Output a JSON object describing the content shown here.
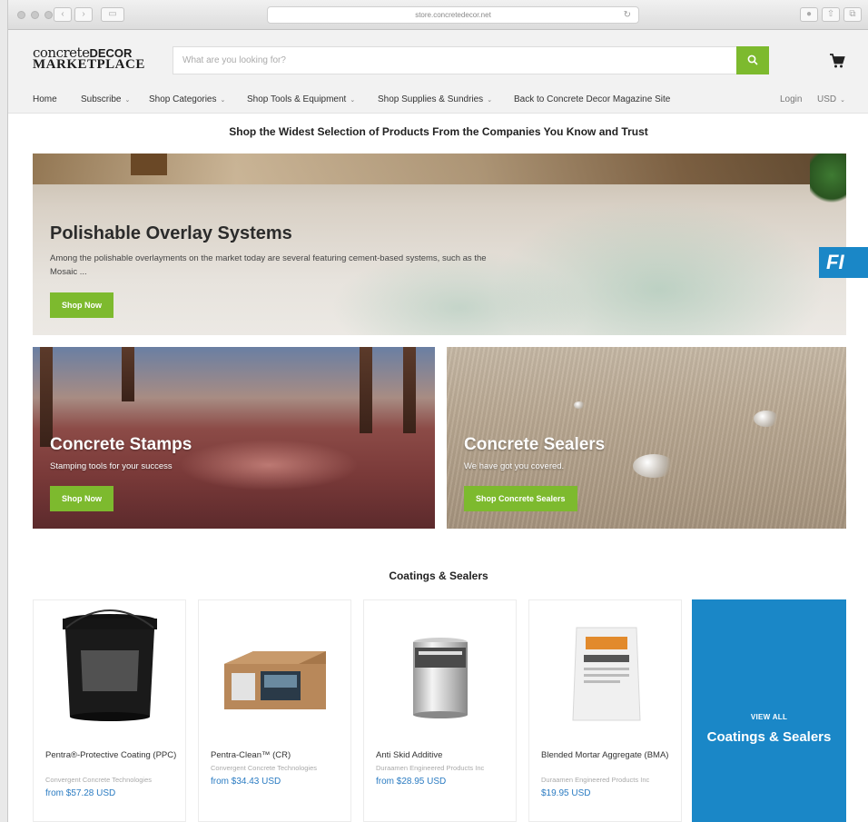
{
  "browser": {
    "url": "store.concretedecor.net"
  },
  "header": {
    "logo_line1_prefix": "concrete",
    "logo_line1_bold": "DECOR",
    "logo_line2": "MARKETPLACE",
    "search_placeholder": "What are you looking for?"
  },
  "nav": {
    "items": [
      {
        "label": "Home"
      },
      {
        "label": "Subscribe"
      },
      {
        "label": "Shop Categories"
      },
      {
        "label": "Shop Tools & Equipment"
      },
      {
        "label": "Shop Supplies & Sundries"
      },
      {
        "label": "Back to Concrete Decor Magazine Site"
      }
    ],
    "login": "Login",
    "currency": "USD"
  },
  "tagline": "Shop the Widest Selection of Products From the Companies You Know and Trust",
  "banners": {
    "overlay": {
      "title": "Polishable Overlay Systems",
      "desc": "Among the polishable overlayments on the market today are several featuring cement-based systems, such as the Mosaic ...",
      "button": "Shop Now"
    },
    "stamps": {
      "title": "Concrete Stamps",
      "desc": "Stamping tools for your success",
      "button": "Shop Now"
    },
    "sealers": {
      "title": "Concrete Sealers",
      "desc": "We have got you covered.",
      "button": "Shop Concrete Sealers"
    }
  },
  "side_badge": "FI",
  "section": {
    "title": "Coatings & Sealers",
    "products": [
      {
        "name": "Pentra®-Protective Coating (PPC)",
        "vendor": "Convergent Concrete Technologies",
        "price": "from $57.28 USD"
      },
      {
        "name": "Pentra-Clean™ (CR)",
        "vendor": "Convergent Concrete Technologies",
        "price": "from $34.43 USD"
      },
      {
        "name": "Anti Skid Additive",
        "vendor": "Duraamen Engineered Products Inc",
        "price": "from $28.95 USD"
      },
      {
        "name": "Blended Mortar Aggregate (BMA)",
        "vendor": "Duraamen Engineered Products Inc",
        "price": "$19.95 USD"
      }
    ],
    "view_all_top": "VIEW ALL",
    "view_all_main": "Coatings & Sealers"
  },
  "colors": {
    "accent_green": "#7dba2e",
    "accent_blue": "#1a87c7",
    "price_blue": "#2a7bc2"
  }
}
